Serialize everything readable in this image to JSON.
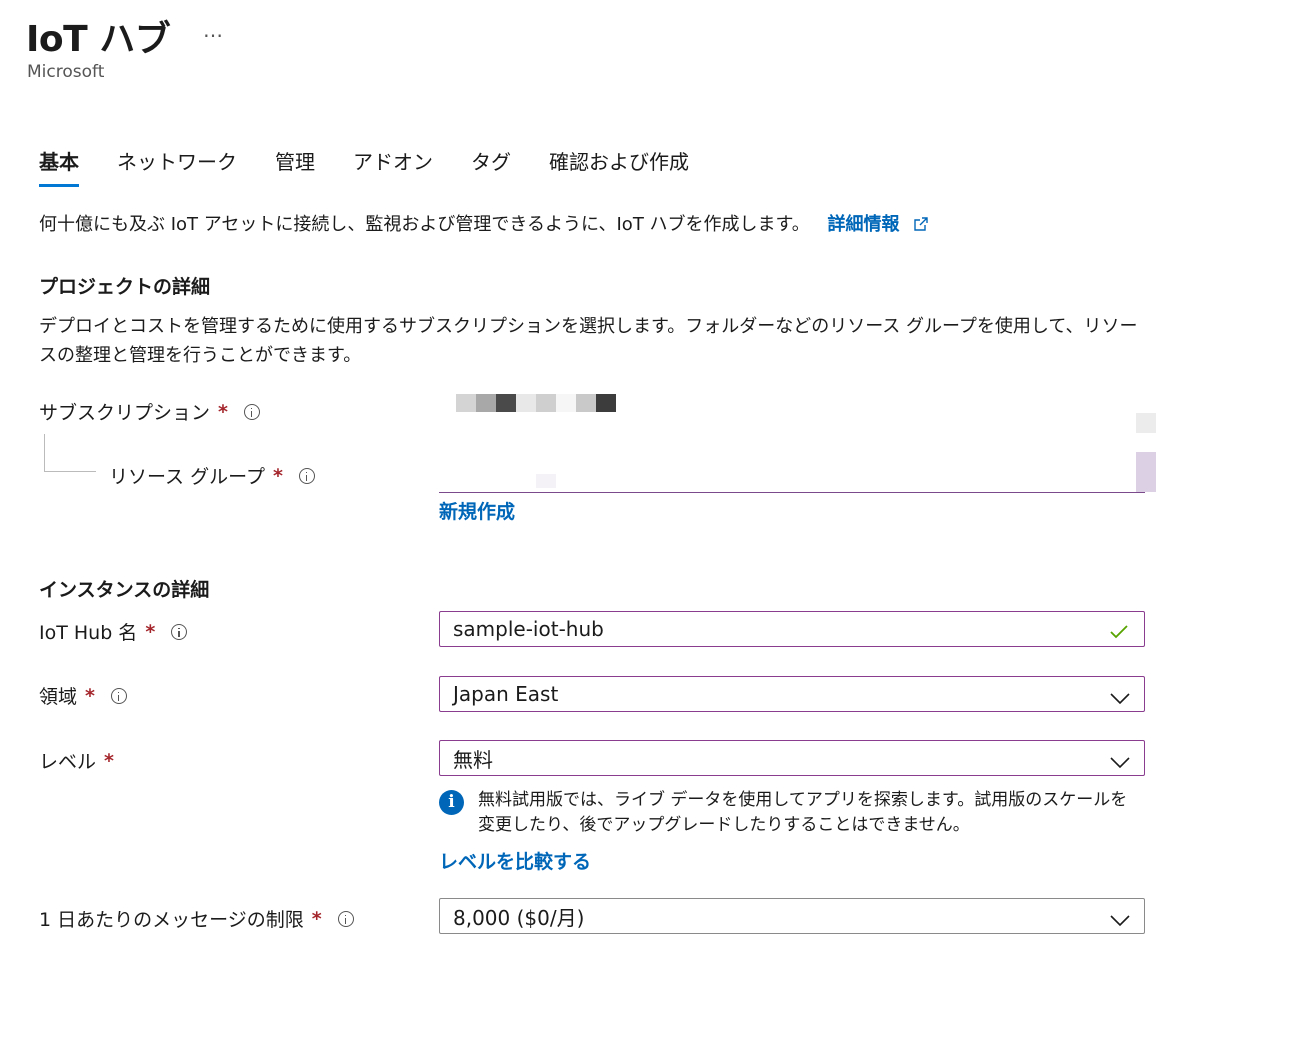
{
  "header": {
    "title": "IoT ハブ",
    "more_label": "…",
    "publisher": "Microsoft"
  },
  "tabs": [
    {
      "label": "基本",
      "active": true
    },
    {
      "label": "ネットワーク",
      "active": false
    },
    {
      "label": "管理",
      "active": false
    },
    {
      "label": "アドオン",
      "active": false
    },
    {
      "label": "タグ",
      "active": false
    },
    {
      "label": "確認および作成",
      "active": false
    }
  ],
  "intro": {
    "text": "何十億にも及ぶ IoT アセットに接続し、監視および管理できるように、IoT ハブを作成します。",
    "link": "詳細情報"
  },
  "project": {
    "heading": "プロジェクトの詳細",
    "description": "デプロイとコストを管理するために使用するサブスクリプションを選択します。フォルダーなどのリソース グループを使用して、リソースの整理と管理を行うことができます。",
    "subscription_label": "サブスクリプション",
    "resource_group_label": "リソース グループ",
    "create_new_link": "新規作成"
  },
  "instance": {
    "heading": "インスタンスの詳細",
    "hub_name_label": "IoT Hub 名",
    "hub_name_value": "sample-iot-hub",
    "region_label": "領域",
    "region_value": "Japan East",
    "tier_label": "レベル",
    "tier_value": "無料",
    "tier_info": "無料試用版では、ライブ データを使用してアプリを探索します。試用版のスケールを変更したり、後でアップグレードしたりすることはできません。",
    "compare_link": "レベルを比較する",
    "daily_limit_label": "1 日あたりのメッセージの制限",
    "daily_limit_value": "8,000 ($0/月)"
  },
  "required_marker": "*",
  "colors": {
    "accent": "#0078d4",
    "link": "#0067b8",
    "field_border_active": "#8a3d8e",
    "required": "#a4262c",
    "valid_check": "#57a300"
  },
  "icons": [
    "more-icon",
    "external-link-icon",
    "info-icon",
    "chevron-down-icon",
    "checkmark-icon",
    "info-filled-icon"
  ]
}
